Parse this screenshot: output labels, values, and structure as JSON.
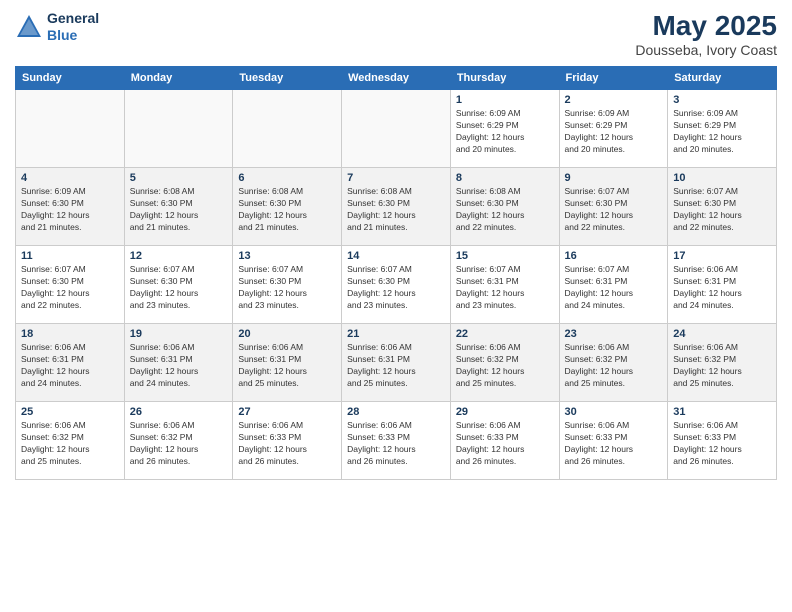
{
  "header": {
    "logo_line1": "General",
    "logo_line2": "Blue",
    "title": "May 2025",
    "subtitle": "Dousseba, Ivory Coast"
  },
  "weekdays": [
    "Sunday",
    "Monday",
    "Tuesday",
    "Wednesday",
    "Thursday",
    "Friday",
    "Saturday"
  ],
  "weeks": [
    [
      {
        "day": "",
        "info": ""
      },
      {
        "day": "",
        "info": ""
      },
      {
        "day": "",
        "info": ""
      },
      {
        "day": "",
        "info": ""
      },
      {
        "day": "1",
        "info": "Sunrise: 6:09 AM\nSunset: 6:29 PM\nDaylight: 12 hours\nand 20 minutes."
      },
      {
        "day": "2",
        "info": "Sunrise: 6:09 AM\nSunset: 6:29 PM\nDaylight: 12 hours\nand 20 minutes."
      },
      {
        "day": "3",
        "info": "Sunrise: 6:09 AM\nSunset: 6:29 PM\nDaylight: 12 hours\nand 20 minutes."
      }
    ],
    [
      {
        "day": "4",
        "info": "Sunrise: 6:09 AM\nSunset: 6:30 PM\nDaylight: 12 hours\nand 21 minutes."
      },
      {
        "day": "5",
        "info": "Sunrise: 6:08 AM\nSunset: 6:30 PM\nDaylight: 12 hours\nand 21 minutes."
      },
      {
        "day": "6",
        "info": "Sunrise: 6:08 AM\nSunset: 6:30 PM\nDaylight: 12 hours\nand 21 minutes."
      },
      {
        "day": "7",
        "info": "Sunrise: 6:08 AM\nSunset: 6:30 PM\nDaylight: 12 hours\nand 21 minutes."
      },
      {
        "day": "8",
        "info": "Sunrise: 6:08 AM\nSunset: 6:30 PM\nDaylight: 12 hours\nand 22 minutes."
      },
      {
        "day": "9",
        "info": "Sunrise: 6:07 AM\nSunset: 6:30 PM\nDaylight: 12 hours\nand 22 minutes."
      },
      {
        "day": "10",
        "info": "Sunrise: 6:07 AM\nSunset: 6:30 PM\nDaylight: 12 hours\nand 22 minutes."
      }
    ],
    [
      {
        "day": "11",
        "info": "Sunrise: 6:07 AM\nSunset: 6:30 PM\nDaylight: 12 hours\nand 22 minutes."
      },
      {
        "day": "12",
        "info": "Sunrise: 6:07 AM\nSunset: 6:30 PM\nDaylight: 12 hours\nand 23 minutes."
      },
      {
        "day": "13",
        "info": "Sunrise: 6:07 AM\nSunset: 6:30 PM\nDaylight: 12 hours\nand 23 minutes."
      },
      {
        "day": "14",
        "info": "Sunrise: 6:07 AM\nSunset: 6:30 PM\nDaylight: 12 hours\nand 23 minutes."
      },
      {
        "day": "15",
        "info": "Sunrise: 6:07 AM\nSunset: 6:31 PM\nDaylight: 12 hours\nand 23 minutes."
      },
      {
        "day": "16",
        "info": "Sunrise: 6:07 AM\nSunset: 6:31 PM\nDaylight: 12 hours\nand 24 minutes."
      },
      {
        "day": "17",
        "info": "Sunrise: 6:06 AM\nSunset: 6:31 PM\nDaylight: 12 hours\nand 24 minutes."
      }
    ],
    [
      {
        "day": "18",
        "info": "Sunrise: 6:06 AM\nSunset: 6:31 PM\nDaylight: 12 hours\nand 24 minutes."
      },
      {
        "day": "19",
        "info": "Sunrise: 6:06 AM\nSunset: 6:31 PM\nDaylight: 12 hours\nand 24 minutes."
      },
      {
        "day": "20",
        "info": "Sunrise: 6:06 AM\nSunset: 6:31 PM\nDaylight: 12 hours\nand 25 minutes."
      },
      {
        "day": "21",
        "info": "Sunrise: 6:06 AM\nSunset: 6:31 PM\nDaylight: 12 hours\nand 25 minutes."
      },
      {
        "day": "22",
        "info": "Sunrise: 6:06 AM\nSunset: 6:32 PM\nDaylight: 12 hours\nand 25 minutes."
      },
      {
        "day": "23",
        "info": "Sunrise: 6:06 AM\nSunset: 6:32 PM\nDaylight: 12 hours\nand 25 minutes."
      },
      {
        "day": "24",
        "info": "Sunrise: 6:06 AM\nSunset: 6:32 PM\nDaylight: 12 hours\nand 25 minutes."
      }
    ],
    [
      {
        "day": "25",
        "info": "Sunrise: 6:06 AM\nSunset: 6:32 PM\nDaylight: 12 hours\nand 25 minutes."
      },
      {
        "day": "26",
        "info": "Sunrise: 6:06 AM\nSunset: 6:32 PM\nDaylight: 12 hours\nand 26 minutes."
      },
      {
        "day": "27",
        "info": "Sunrise: 6:06 AM\nSunset: 6:33 PM\nDaylight: 12 hours\nand 26 minutes."
      },
      {
        "day": "28",
        "info": "Sunrise: 6:06 AM\nSunset: 6:33 PM\nDaylight: 12 hours\nand 26 minutes."
      },
      {
        "day": "29",
        "info": "Sunrise: 6:06 AM\nSunset: 6:33 PM\nDaylight: 12 hours\nand 26 minutes."
      },
      {
        "day": "30",
        "info": "Sunrise: 6:06 AM\nSunset: 6:33 PM\nDaylight: 12 hours\nand 26 minutes."
      },
      {
        "day": "31",
        "info": "Sunrise: 6:06 AM\nSunset: 6:33 PM\nDaylight: 12 hours\nand 26 minutes."
      }
    ]
  ]
}
